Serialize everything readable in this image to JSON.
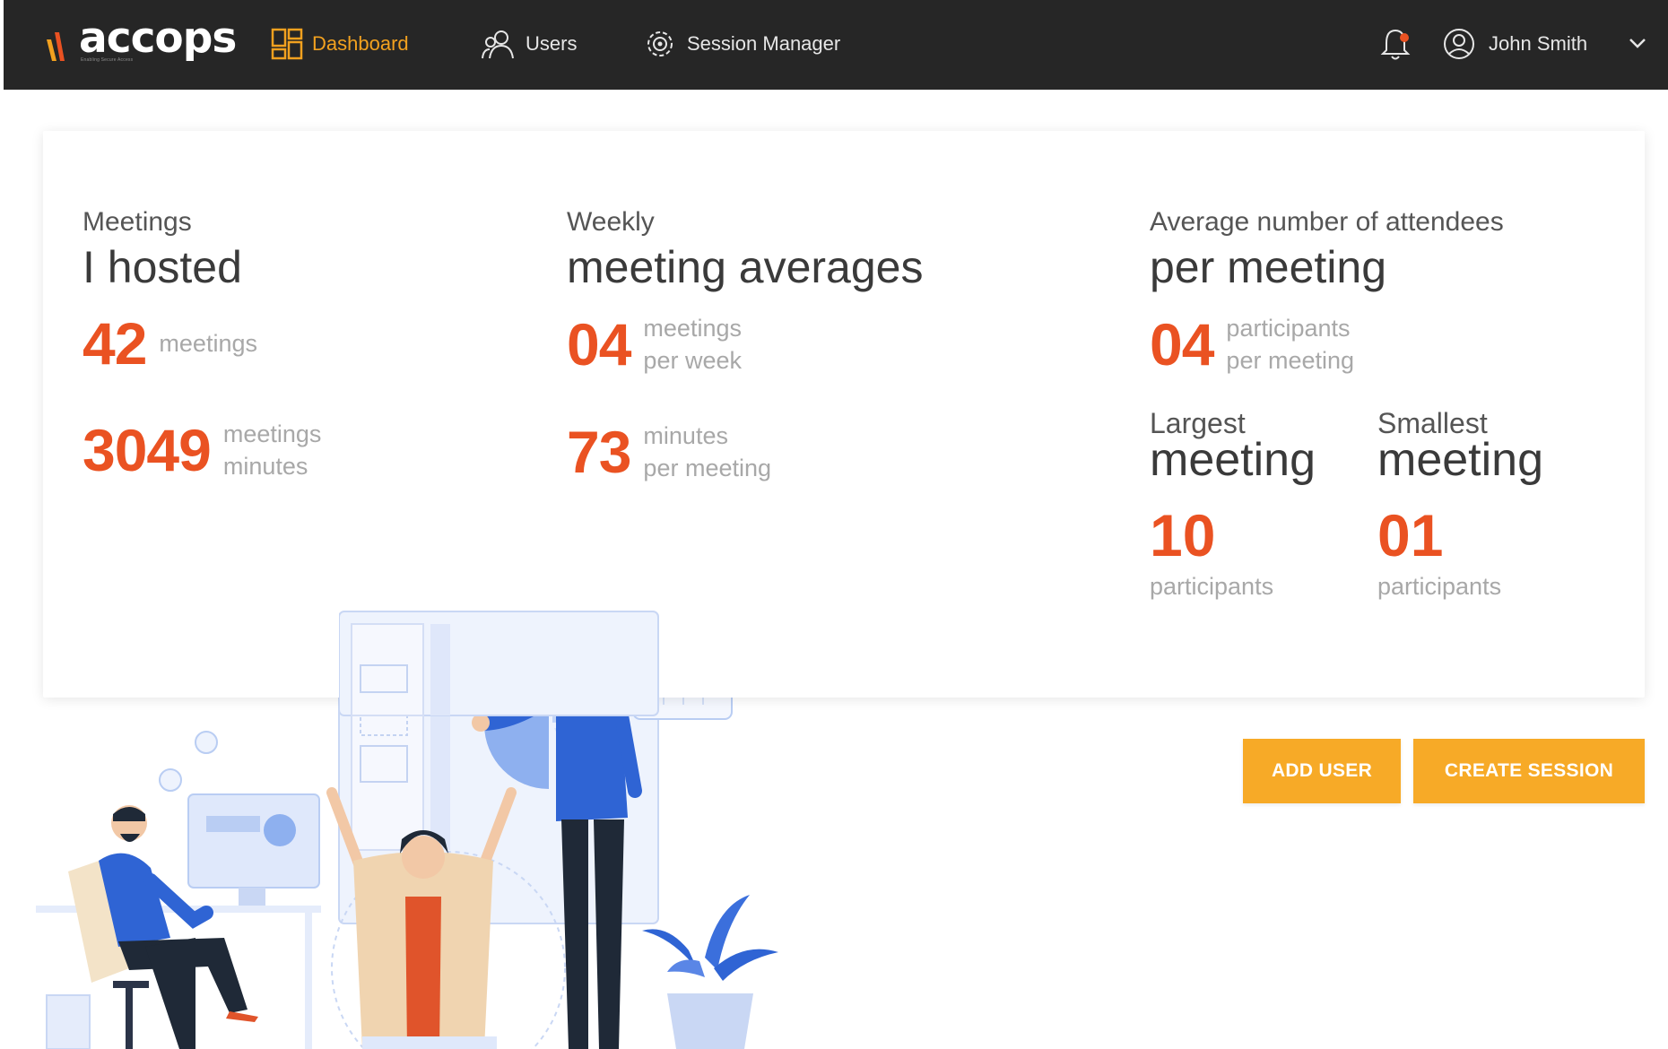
{
  "app": {
    "logo_text": "accops",
    "logo_tagline": "Enabling Secure Access",
    "brand_color": "#f2a11f",
    "accent_color": "#ea5222"
  },
  "nav": {
    "items": [
      {
        "label": "Dashboard",
        "icon": "dashboard-icon",
        "active": true
      },
      {
        "label": "Users",
        "icon": "users-icon",
        "active": false
      },
      {
        "label": "Session Manager",
        "icon": "session-manager-icon",
        "active": false
      }
    ],
    "notification_icon": "bell-icon",
    "user": {
      "name": "John Smith",
      "icon": "user-avatar-icon",
      "menu_icon": "chevron-down-icon"
    }
  },
  "stats": {
    "hosted": {
      "label": "Meetings",
      "headline": "I hosted",
      "meetings_value": "42",
      "meetings_unit": "meetings",
      "minutes_value": "3049",
      "minutes_unit_1": "meetings",
      "minutes_unit_2": "minutes"
    },
    "weekly": {
      "label": "Weekly",
      "headline": "meeting averages",
      "meetings_value": "04",
      "meetings_unit_1": "meetings",
      "meetings_unit_2": "per week",
      "minutes_value": "73",
      "minutes_unit_1": "minutes",
      "minutes_unit_2": "per meeting"
    },
    "attendees": {
      "label": "Average number of attendees",
      "headline": "per meeting",
      "value": "04",
      "unit_1": "participants",
      "unit_2": "per meeting",
      "largest": {
        "title_small": "Largest",
        "title_big": "meeting",
        "value": "10",
        "unit": "participants"
      },
      "smallest": {
        "title_small": "Smallest",
        "title_big": "meeting",
        "value": "01",
        "unit": "participants"
      }
    }
  },
  "actions": {
    "add_user": "ADD USER",
    "create_session": "CREATE SESSION"
  },
  "illustration": {
    "pie_label": "%"
  }
}
